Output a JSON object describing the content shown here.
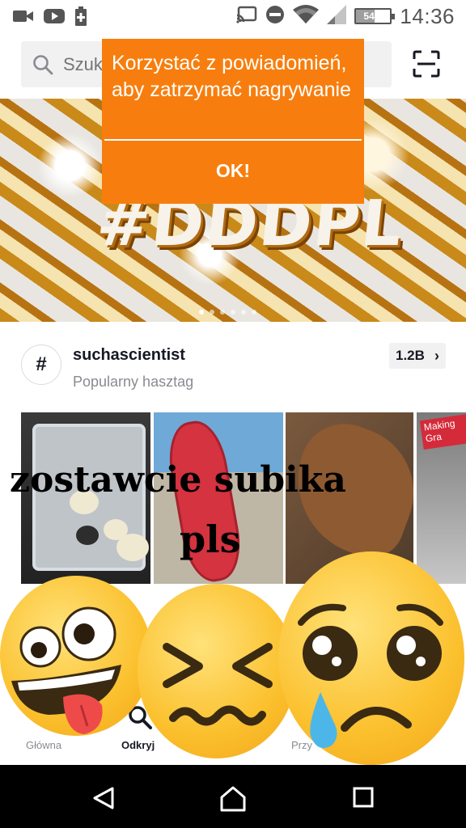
{
  "status_bar": {
    "time": "14:36",
    "battery": "54%",
    "battery_level": 0.54,
    "icons": [
      "video-camera-icon",
      "youtube-icon",
      "battery-saver-icon",
      "cast-icon",
      "do-not-disturb-icon",
      "wifi-icon",
      "signal-icon",
      "battery-icon"
    ]
  },
  "search": {
    "placeholder": "Szukaj",
    "scan_icon": "scan-icon"
  },
  "banner": {
    "text": "#DDDPL",
    "slide_count": 6,
    "active_slide": 1
  },
  "popup": {
    "message": "Korzystać z powiadomień, aby zatrzymać nagrywanie",
    "ok_label": "OK!"
  },
  "hashtag": {
    "symbol": "#",
    "name": "suchascientist",
    "subtitle": "Popularny hasztag",
    "count": "1.2B",
    "thumbnails": [
      {
        "tag": ""
      },
      {
        "tag": ""
      },
      {
        "tag": ""
      },
      {
        "tag": "Making Gra"
      }
    ]
  },
  "overlay": {
    "caption_line1": "zostawcie subika",
    "caption_line2": "pls",
    "emojis": [
      "zany-face-emoji",
      "confounded-face-emoji",
      "sad-sweat-face-emoji"
    ]
  },
  "bottom_nav": {
    "home_label": "Główna",
    "discover_label": "Odkryj",
    "inbox_label": "Przy"
  },
  "colors": {
    "popup": "#f77e0e",
    "emoji": "#fbc02d",
    "nav_bar": "#000000"
  }
}
